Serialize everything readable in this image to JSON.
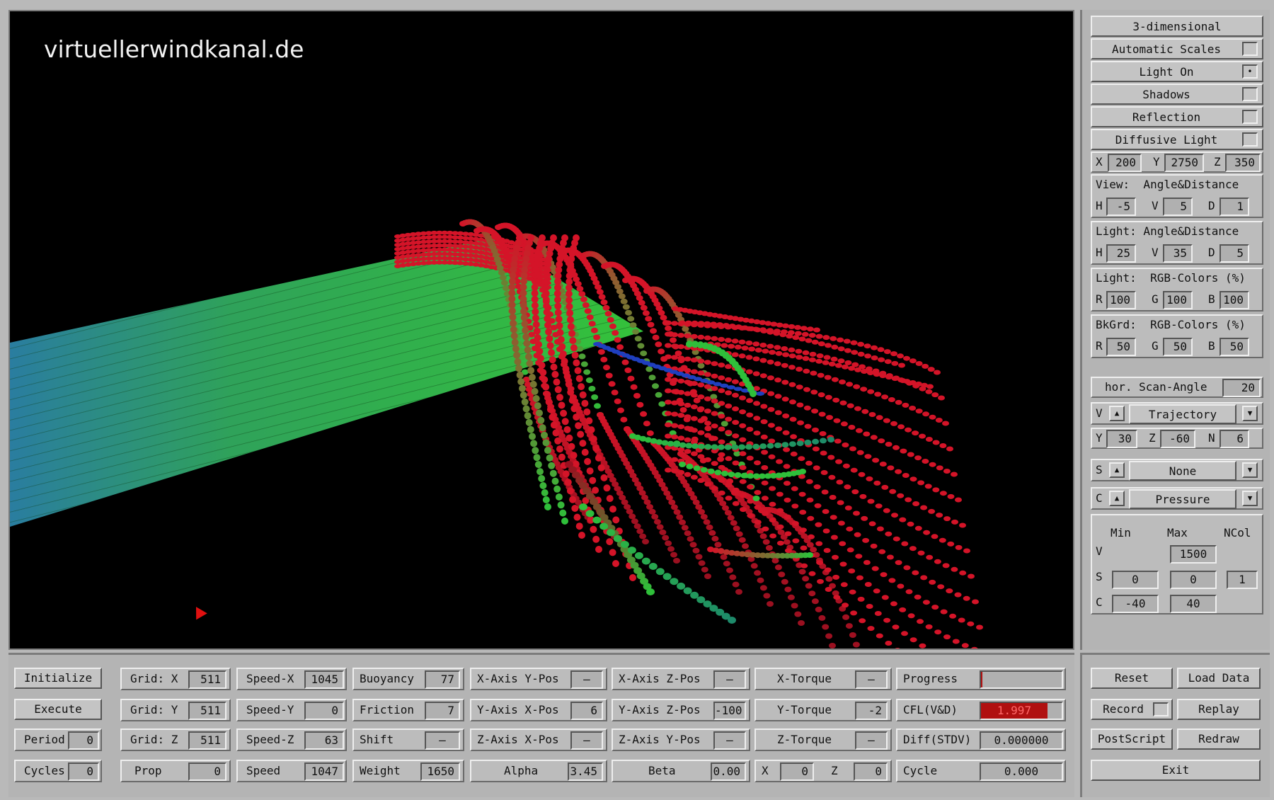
{
  "watermark": "virtuellerwindkanal.de",
  "side": {
    "toggles": [
      {
        "label": "3-dimensional"
      },
      {
        "label": "Automatic Scales",
        "checked": false
      },
      {
        "label": "Light On",
        "checked": true
      },
      {
        "label": "Shadows",
        "checked": false
      },
      {
        "label": "Reflection",
        "checked": false
      },
      {
        "label": "Diffusive Light",
        "checked": false
      }
    ],
    "pos": {
      "x_label": "X",
      "x": "200",
      "y_label": "Y",
      "y": "2750",
      "z_label": "Z",
      "z": "350"
    },
    "view": {
      "title": "View:  Angle&Distance",
      "h_label": "H",
      "h": "-5",
      "v_label": "V",
      "v": "5",
      "d_label": "D",
      "d": "1"
    },
    "light": {
      "title": "Light: Angle&Distance",
      "h_label": "H",
      "h": "25",
      "v_label": "V",
      "v": "35",
      "d_label": "D",
      "d": "5"
    },
    "light_rgb": {
      "title": "Light:  RGB-Colors (%)",
      "r_label": "R",
      "r": "100",
      "g_label": "G",
      "g": "100",
      "b_label": "B",
      "b": "100"
    },
    "bkgrd_rgb": {
      "title": "BkGrd:  RGB-Colors (%)",
      "r_label": "R",
      "r": "50",
      "g_label": "G",
      "g": "50",
      "b_label": "B",
      "b": "50"
    },
    "scan": {
      "label": "hor. Scan-Angle",
      "value": "20"
    },
    "sel_v": {
      "key": "V",
      "value": "Trajectory"
    },
    "traj": {
      "y_label": "Y",
      "y": "30",
      "z_label": "Z",
      "z": "-60",
      "n_label": "N",
      "n": "6"
    },
    "sel_s": {
      "key": "S",
      "value": "None"
    },
    "sel_c": {
      "key": "C",
      "value": "Pressure"
    },
    "scales": {
      "min": "Min",
      "max": "Max",
      "ncol": "NCol",
      "v_label": "V",
      "v_max": "1500",
      "s_label": "S",
      "s_min": "0",
      "s_max": "0",
      "s_ncol": "1",
      "c_label": "C",
      "c_min": "-40",
      "c_max": "40"
    },
    "icons": {
      "checkbox_on": "•",
      "up": "▲",
      "down": "▼"
    }
  },
  "bottom": {
    "row1": {
      "initialize": "Initialize",
      "grid_x_label": "Grid: X",
      "grid_x": "511",
      "speed_x_label": "Speed-X",
      "speed_x": "1045",
      "buoyancy_label": "Buoyancy",
      "buoyancy": "77",
      "xaxis_ypos_label": "X-Axis Y-Pos",
      "xaxis_ypos": "—",
      "xaxis_zpos_label": "X-Axis Z-Pos",
      "xaxis_zpos": "—",
      "xtorque_label": "X-Torque",
      "xtorque": "—",
      "progress_label": "Progress"
    },
    "row2": {
      "execute": "Execute",
      "grid_y_label": "Grid: Y",
      "grid_y": "511",
      "speed_y_label": "Speed-Y",
      "speed_y": "0",
      "friction_label": "Friction",
      "friction": "7",
      "yaxis_xpos_label": "Y-Axis X-Pos",
      "yaxis_xpos": "6",
      "yaxis_zpos_label": "Y-Axis Z-Pos",
      "yaxis_zpos": "-100",
      "ytorque_label": "Y-Torque",
      "ytorque": "-2",
      "cfl_label": "CFL(V&D)",
      "cfl": "1.997"
    },
    "row3": {
      "period_label": "Period",
      "period": "0",
      "grid_z_label": "Grid: Z",
      "grid_z": "511",
      "speed_z_label": "Speed-Z",
      "speed_z": "63",
      "shift_label": "Shift",
      "shift": "—",
      "zaxis_xpos_label": "Z-Axis X-Pos",
      "zaxis_xpos": "—",
      "zaxis_ypos_label": "Z-Axis Y-Pos",
      "zaxis_ypos": "—",
      "ztorque_label": "Z-Torque",
      "ztorque": "—",
      "diff_label": "Diff(STDV)",
      "diff": "0.000000"
    },
    "row4": {
      "cycles_label": "Cycles",
      "cycles": "0",
      "prop_label": "Prop",
      "prop": "0",
      "speed_label": "Speed",
      "speed": "1047",
      "weight_label": "Weight",
      "weight": "1650",
      "alpha_label": "Alpha",
      "alpha": "3.45",
      "beta_label": "Beta",
      "beta": "0.00",
      "x_label": "X",
      "x": "0",
      "z_label": "Z",
      "z": "0",
      "cycle_label": "Cycle",
      "cycle": "0.000"
    }
  },
  "controls": {
    "reset": "Reset",
    "load_data": "Load Data",
    "record": "Record",
    "replay": "Replay",
    "postscript": "PostScript",
    "redraw": "Redraw",
    "exit": "Exit"
  },
  "colors": {
    "panel": "#b4b4b4",
    "viewport_bg": "#000000",
    "wing_near": "#2fb52f",
    "wing_far": "#2f7fa0",
    "stream_red": "#d41428",
    "cfl_bar": "#b01010"
  }
}
